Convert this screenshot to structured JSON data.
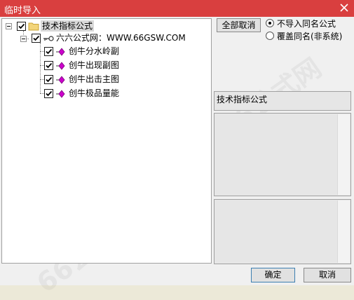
{
  "window": {
    "title": "临时导入"
  },
  "tree": {
    "root": {
      "label": "技术指标公式",
      "checked": true
    },
    "source": {
      "label": "六六公式网：WWW.66GSW.COM",
      "checked": true
    },
    "items": [
      {
        "label": "创牛分水岭副",
        "checked": true
      },
      {
        "label": "创牛出现副图",
        "checked": true
      },
      {
        "label": "创牛出击主图",
        "checked": true
      },
      {
        "label": "创牛极品量能",
        "checked": true
      }
    ]
  },
  "options": {
    "select_all_label": "全部取消",
    "radio_no_import": "不导入同名公式",
    "radio_overwrite": "覆盖同名(非系统)",
    "selected": "radio_no_import"
  },
  "info": {
    "category_label": "技术指标公式"
  },
  "footer": {
    "ok_label": "确定",
    "cancel_label": "取消"
  },
  "watermark": {
    "text": "66公式网"
  },
  "colors": {
    "titlebar": "#d93f3f",
    "item_icon": "#cc00cc"
  }
}
